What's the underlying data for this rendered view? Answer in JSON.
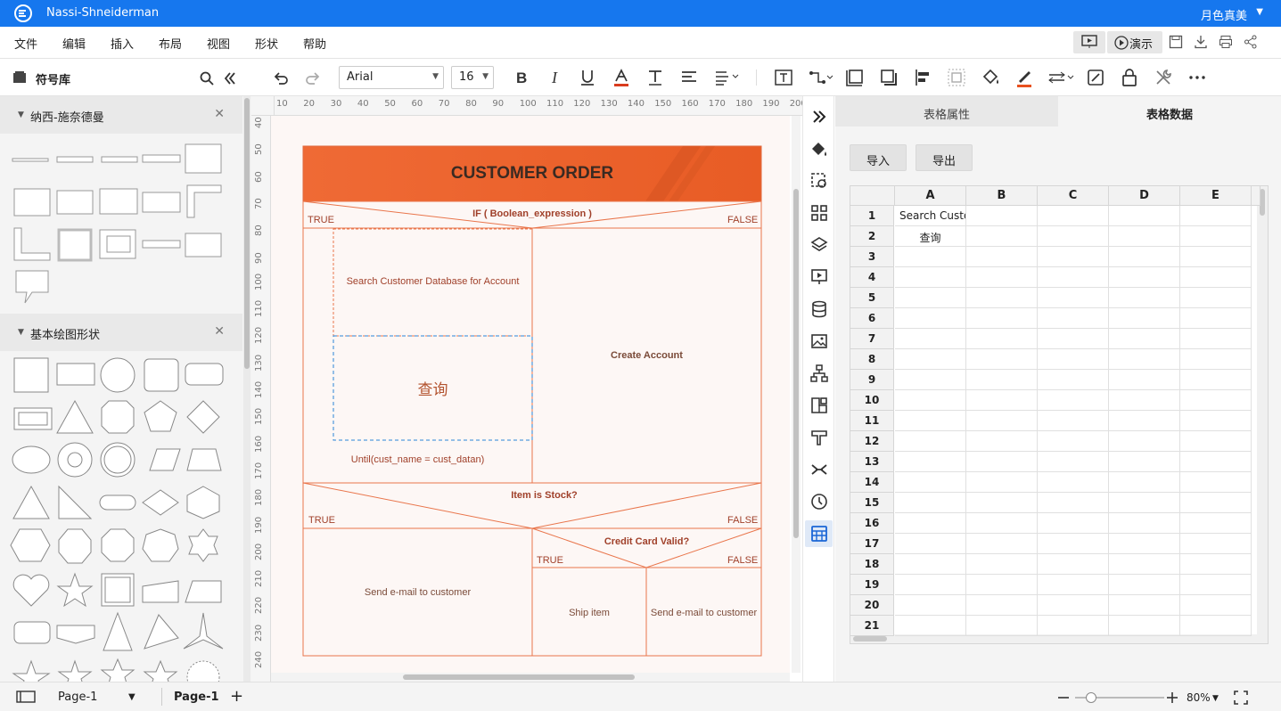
{
  "app": {
    "title": "Nassi-Shneiderman",
    "user": "月色真美"
  },
  "menu": [
    "文件",
    "编辑",
    "插入",
    "布局",
    "视图",
    "形状",
    "帮助"
  ],
  "topright": {
    "present_label": "演示"
  },
  "library": {
    "title": "符号库",
    "sections": [
      {
        "title": "纳西-施奈德曼"
      },
      {
        "title": "基本绘图形状"
      }
    ]
  },
  "toolbar": {
    "font": "Arial",
    "font_size": "16"
  },
  "ruler": {
    "top": [
      "10",
      "20",
      "30",
      "40",
      "50",
      "60",
      "70",
      "80",
      "90",
      "100",
      "110",
      "120",
      "130",
      "140",
      "150",
      "160",
      "170",
      "180",
      "190",
      "200"
    ],
    "left": [
      "40",
      "50",
      "60",
      "70",
      "80",
      "90",
      "100",
      "110",
      "120",
      "130",
      "140",
      "150",
      "160",
      "170",
      "180",
      "190",
      "200",
      "210",
      "220",
      "230",
      "240"
    ]
  },
  "diagram": {
    "title": "CUSTOMER ORDER",
    "if1": "IF ( Boolean_expression )",
    "true": "TRUE",
    "false": "FALSE",
    "search": "Search Customer Database for Account",
    "query": "查询",
    "until": "Until(cust_name = cust_datan)",
    "create": "Create Account",
    "stock": "Item is Stock?",
    "credit": "Credit Card Valid?",
    "send_email": "Send e-mail to customer",
    "ship": "Ship item",
    "send_email2": "Send e-mail to customer",
    "colors": {
      "accent": "#ea6330",
      "line": "#e9754b",
      "text": "#a0402a"
    }
  },
  "rightpanel": {
    "tabs": [
      "表格属性",
      "表格数据"
    ],
    "active_tab": "表格数据",
    "import_label": "导入",
    "export_label": "导出",
    "columns": [
      "A",
      "B",
      "C",
      "D",
      "E"
    ],
    "rows": [
      "1",
      "2",
      "3",
      "4",
      "5",
      "6",
      "7",
      "8",
      "9",
      "10",
      "11",
      "12",
      "13",
      "14",
      "15",
      "16",
      "17",
      "18",
      "19",
      "20",
      "21"
    ],
    "cells": {
      "A1": "Search Custo",
      "A2": "查询"
    }
  },
  "status": {
    "page_select": "Page-1",
    "page_tab": "Page-1",
    "zoom": "80%"
  }
}
